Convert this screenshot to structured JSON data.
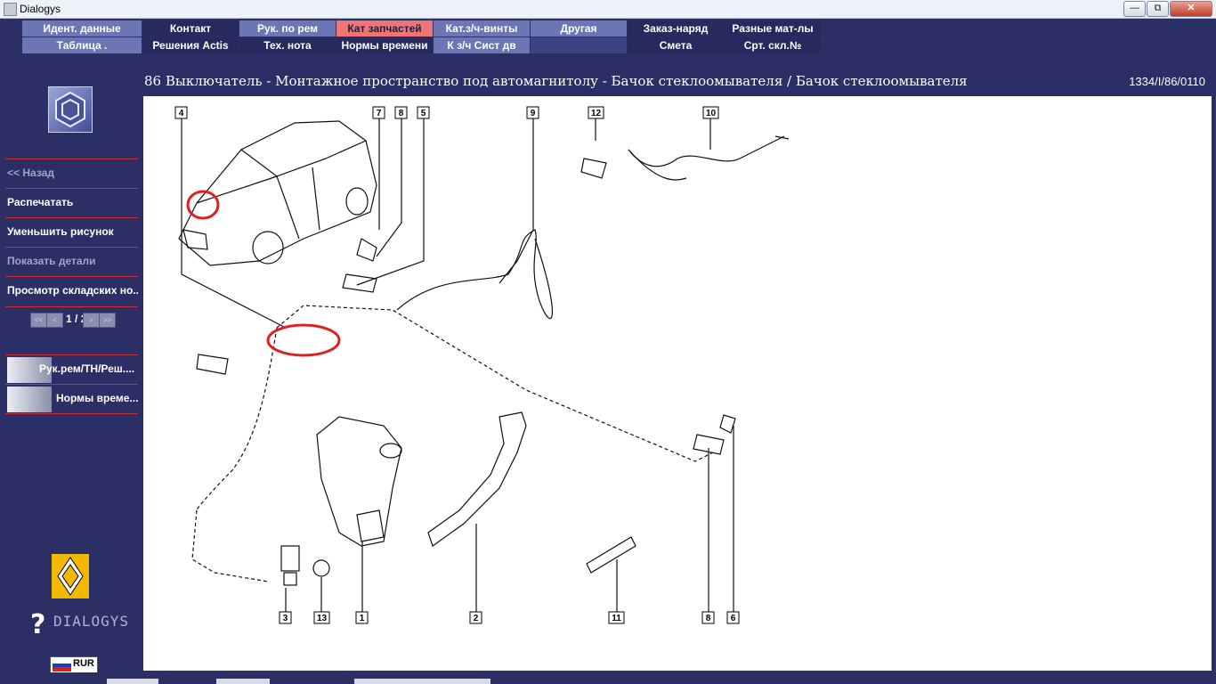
{
  "window": {
    "title": "Dialogys",
    "min_label": "—",
    "max_label": "⧉",
    "close_label": "✕"
  },
  "menu": {
    "row1": [
      {
        "label": "Идент. данные"
      },
      {
        "label": "Контакт"
      },
      {
        "label": "Рук. по рем"
      },
      {
        "label": "Кат запчастей"
      },
      {
        "label": "Кат.з/ч-винты"
      },
      {
        "label": "Другая"
      },
      {
        "label": "Заказ-наряд"
      },
      {
        "label": "Разные мат-лы"
      }
    ],
    "row2": [
      {
        "label": "Таблица ."
      },
      {
        "label": "Решения Actis"
      },
      {
        "label": "Тех. нота"
      },
      {
        "label": "Нормы времени"
      },
      {
        "label": "К з/ч Сист дв"
      },
      {
        "label": "Смета"
      },
      {
        "label": "Срт. скл.№"
      }
    ]
  },
  "page": {
    "heading": "86 Выключатель - Монтажное пространство под автомагнитолу - Бачок стеклоомывателя / Бачок стеклоомывателя",
    "ref_code": "1334/I/86/0110"
  },
  "sidebar": {
    "back": "<< Назад",
    "print": "Распечатать",
    "shrink": "Уменьшить рисунок",
    "show_details": "Показать детали",
    "stock_view": "Просмотр складских но...",
    "pager": {
      "current": "1",
      "separator": "/",
      "total": "2",
      "first": "<<",
      "prev": "<",
      "next": ">",
      "last": ">>"
    },
    "tools": [
      {
        "label": "Рук.рем/ТН/Реш...."
      },
      {
        "label": "Нормы време..."
      }
    ],
    "brand_text": "DIALOGYS",
    "brand_mark": "?",
    "currency": "RUR"
  },
  "diagram": {
    "callouts": [
      "4",
      "7",
      "8",
      "5",
      "9",
      "12",
      "10",
      "3",
      "13",
      "1",
      "2",
      "11",
      "8",
      "6"
    ]
  }
}
